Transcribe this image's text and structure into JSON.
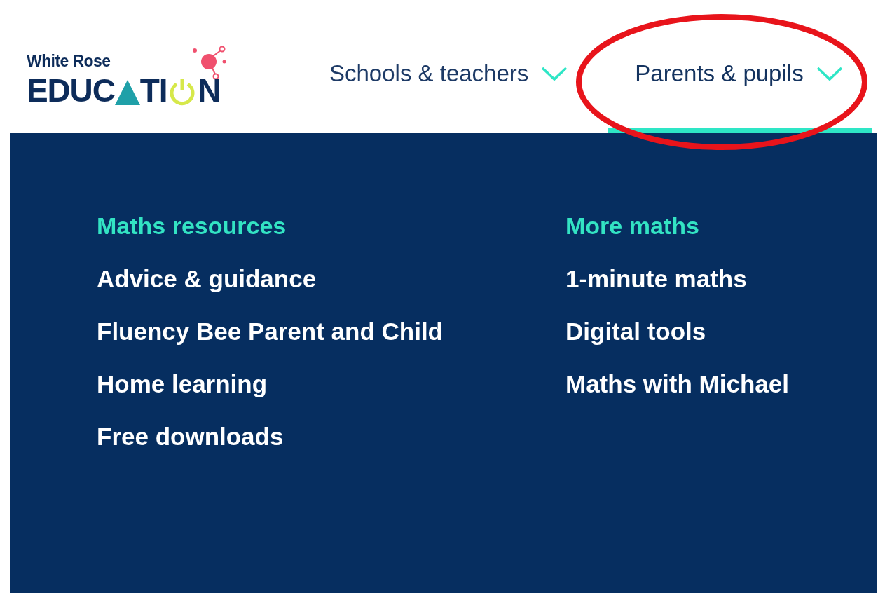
{
  "logo": {
    "top_line": "White Rose",
    "word_parts": [
      "EDUC",
      "TI",
      "N"
    ]
  },
  "nav": [
    {
      "label": "Schools & teachers",
      "selected": false
    },
    {
      "label": "Parents & pupils",
      "selected": true
    }
  ],
  "menu": {
    "columns": [
      {
        "heading": "Maths resources",
        "items": [
          "Advice & guidance",
          "Fluency Bee Parent and Child",
          "Home learning",
          "Free downloads"
        ]
      },
      {
        "heading": "More maths",
        "items": [
          "1-minute maths",
          "Digital tools",
          "Maths with Michael"
        ]
      }
    ]
  },
  "annotation": {
    "kind": "ellipse",
    "color": "#e8141b"
  }
}
